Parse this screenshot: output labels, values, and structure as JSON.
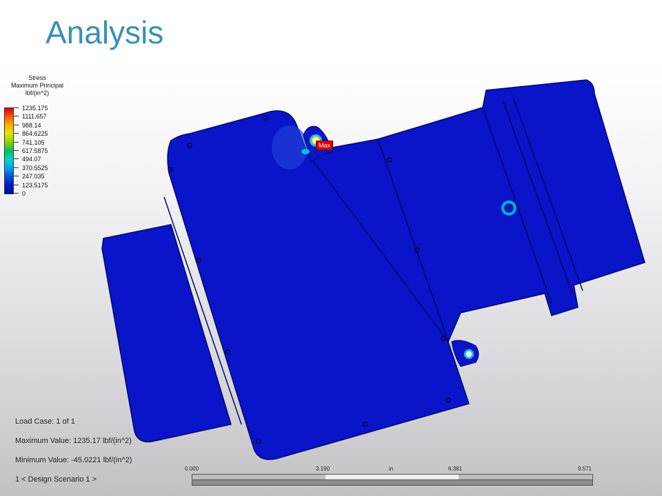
{
  "slide": {
    "title": "Analysis"
  },
  "legend": {
    "title_lines": [
      "Stress",
      "Maximum Principal",
      "lbf/(in^2)"
    ],
    "values": [
      "1235.175",
      "1111.657",
      "988.14",
      "864.6225",
      "741.105",
      "617.5875",
      "494.07",
      "370.5525",
      "247.035",
      "123.5175",
      "0"
    ]
  },
  "probe": {
    "max_label": "Max"
  },
  "info": {
    "load_case": "Load Case:  1 of 1",
    "max_value": "Maximum Value: 1235.17 lbf/(in^2)",
    "min_value": "Minimum Value: -45.0221 lbf/(in^2)",
    "scenario": "1 < Design Scenario 1 >"
  },
  "scale": {
    "labels": [
      "0.000",
      "3.190",
      "in",
      "6.381",
      "9.571"
    ]
  },
  "colors": {
    "title": "#3b8fb8",
    "model": "#0a14c8",
    "max_tag": "#d60000"
  }
}
